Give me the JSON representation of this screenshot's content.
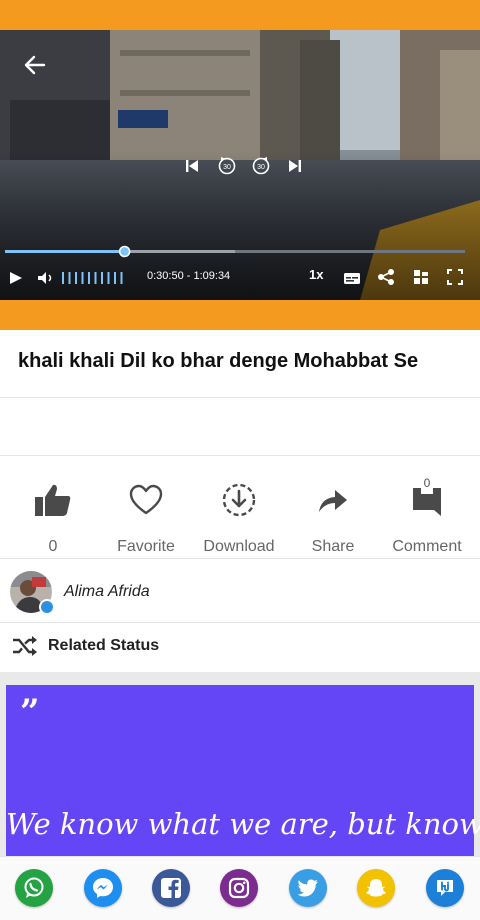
{
  "player": {
    "time": "0:30:50 - 1:09:34",
    "speed": "1x",
    "progress_fraction": 0.26,
    "buffered_fraction": 0.5,
    "volume_bars": 10
  },
  "post": {
    "title": "khali khali Dil ko bhar denge Mohabbat Se"
  },
  "actions": {
    "like_count": "0",
    "favorite_label": "Favorite",
    "download_label": "Download",
    "share_label": "Share",
    "comment_label": "Comment",
    "comment_count": "0"
  },
  "author": {
    "name": "Alima Afrida"
  },
  "related": {
    "label": "Related Status"
  },
  "quote_card": {
    "mark": "”",
    "text": "We know what we are, but know"
  },
  "share_apps": [
    {
      "icon": "whatsapp-icon",
      "color": "#25a244"
    },
    {
      "icon": "messenger-icon",
      "color": "#1f8ef1"
    },
    {
      "icon": "facebook-icon",
      "color": "#3b5998"
    },
    {
      "icon": "instagram-icon",
      "color": "#7b2c8f"
    },
    {
      "icon": "twitter-icon",
      "color": "#3a9ee4"
    },
    {
      "icon": "snapchat-icon",
      "color": "#f2c100"
    },
    {
      "icon": "hike-icon",
      "color": "#1c7fd8"
    }
  ],
  "colors": {
    "accent_orange": "#f39a1f",
    "quote_purple": "#6546f6",
    "progress_blue": "#7ec3f5"
  }
}
